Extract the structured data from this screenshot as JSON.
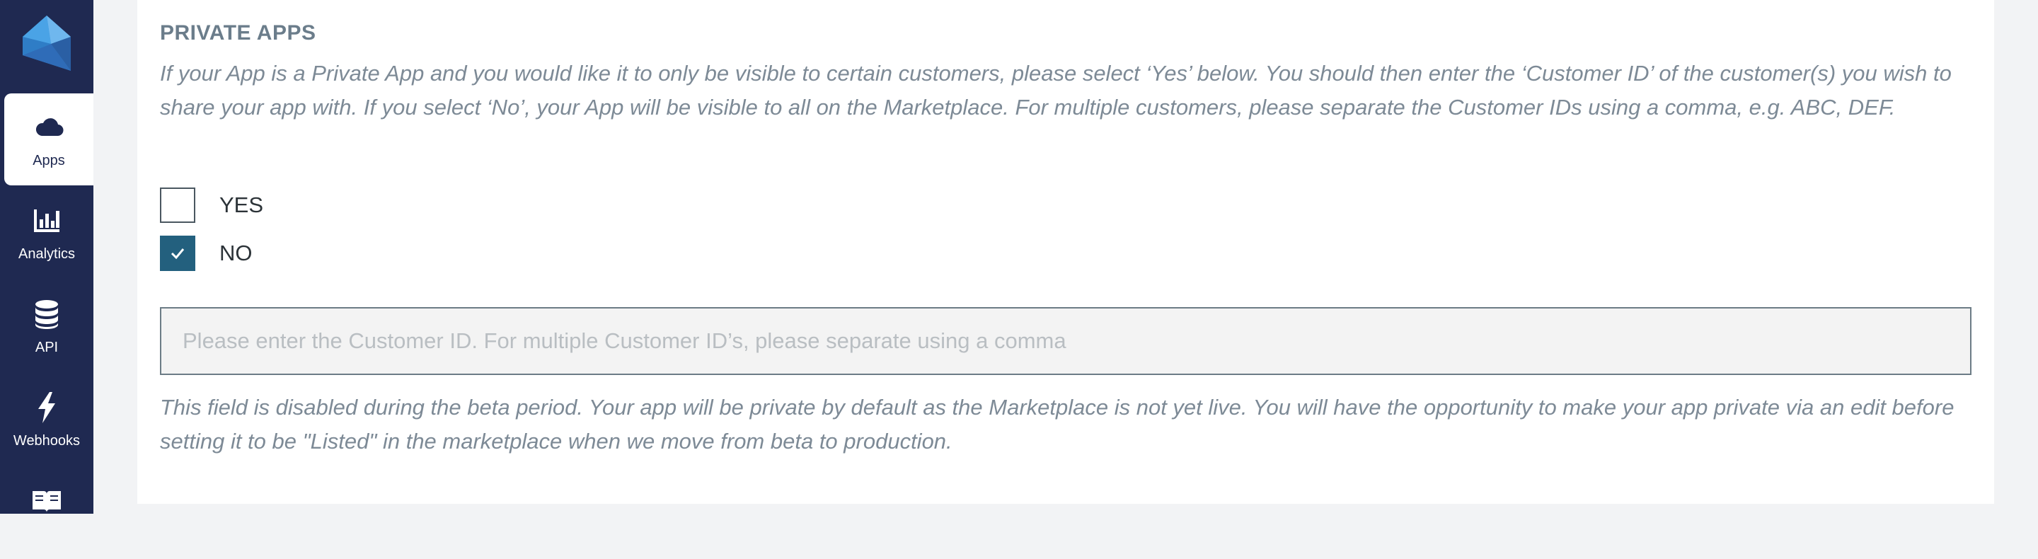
{
  "sidebar": {
    "items": [
      {
        "label": "Apps",
        "icon": "cloud-icon",
        "active": true
      },
      {
        "label": "Analytics",
        "icon": "bar-chart-icon",
        "active": false
      },
      {
        "label": "API",
        "icon": "database-icon",
        "active": false
      },
      {
        "label": "Webhooks",
        "icon": "lightning-icon",
        "active": false
      },
      {
        "label": "",
        "icon": "book-icon",
        "active": false
      }
    ]
  },
  "section": {
    "title": "PRIVATE APPS",
    "help": "If your App is a Private App and you would like it to only be visible to certain customers, please select ‘Yes’ below. You should then enter the ‘Customer ID’ of the customer(s) you wish to share your app with. If you select ‘No’, your App will be visible to all on the Marketplace. For multiple customers, please separate the Customer IDs using a comma, e.g. ABC, DEF."
  },
  "options": [
    {
      "label": "YES",
      "checked": false
    },
    {
      "label": "NO",
      "checked": true
    }
  ],
  "customer_id_input": {
    "value": "",
    "placeholder": "Please enter the Customer ID. For multiple Customer ID’s, please separate using a comma"
  },
  "note": "This field is disabled during the beta period. Your app will be private by default as the Marketplace is not yet live. You will have the opportunity to make your app private via an edit before setting it to be \"Listed\" in the marketplace when we move from beta to production.",
  "colors": {
    "sidebar_bg": "#1f2951",
    "checkbox_checked": "#23607e",
    "muted_text": "#7d8a96"
  }
}
